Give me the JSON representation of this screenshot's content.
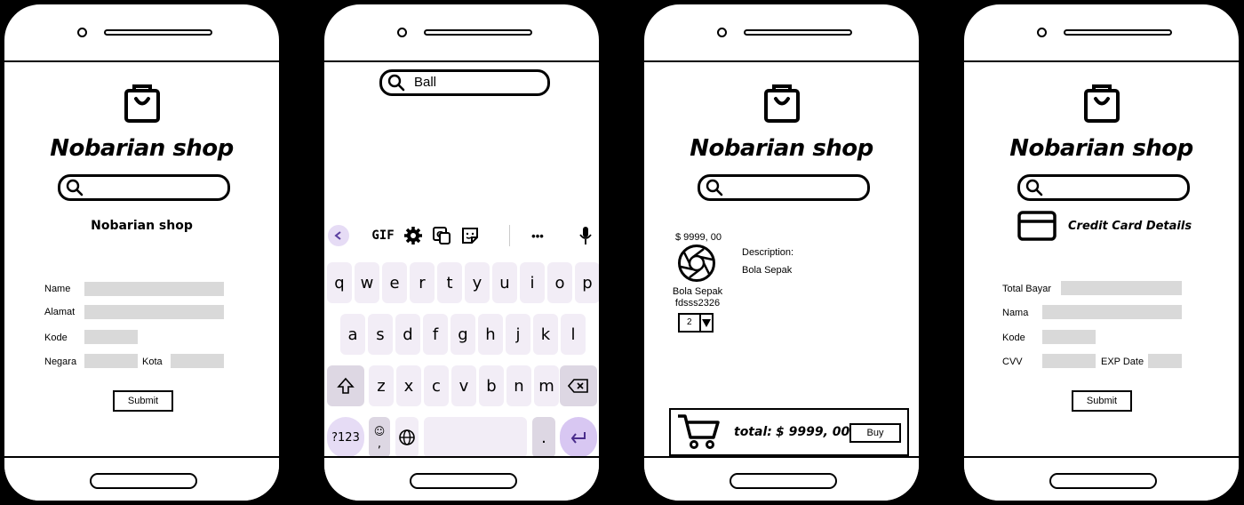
{
  "shop_name": "Nobarian shop",
  "phone1": {
    "subtitle": "Nobarian shop",
    "labels": {
      "name": "Name",
      "alamat": "Alamat",
      "kode": "Kode",
      "negara": "Negara",
      "kota": "Kota"
    },
    "submit_label": "Submit"
  },
  "phone2": {
    "search_value": "Ball",
    "toolbar": {
      "gif": "GIF",
      "more": "•••"
    },
    "rows": [
      [
        "q",
        "w",
        "e",
        "r",
        "t",
        "y",
        "u",
        "i",
        "o",
        "p"
      ],
      [
        "a",
        "s",
        "d",
        "f",
        "g",
        "h",
        "j",
        "k",
        "l"
      ],
      [
        "z",
        "x",
        "c",
        "v",
        "b",
        "n",
        "m"
      ]
    ],
    "keys": {
      "symbols": "?123",
      "comma": ",",
      "period": "."
    }
  },
  "phone3": {
    "price": "$ 9999, 00",
    "product_name": "Bola Sepak",
    "product_code": "fdsss2326",
    "quantity": "2",
    "description_label": "Description:",
    "description_value": "Bola Sepak",
    "total_label": "total:",
    "total_value": "$ 9999, 00",
    "buy_label": "Buy"
  },
  "phone4": {
    "title": "Credit Card Details",
    "labels": {
      "total": "Total Bayar",
      "nama": "Nama",
      "kode": "Kode",
      "cvv": "CVV",
      "exp": "EXP Date"
    },
    "submit_label": "Submit"
  }
}
